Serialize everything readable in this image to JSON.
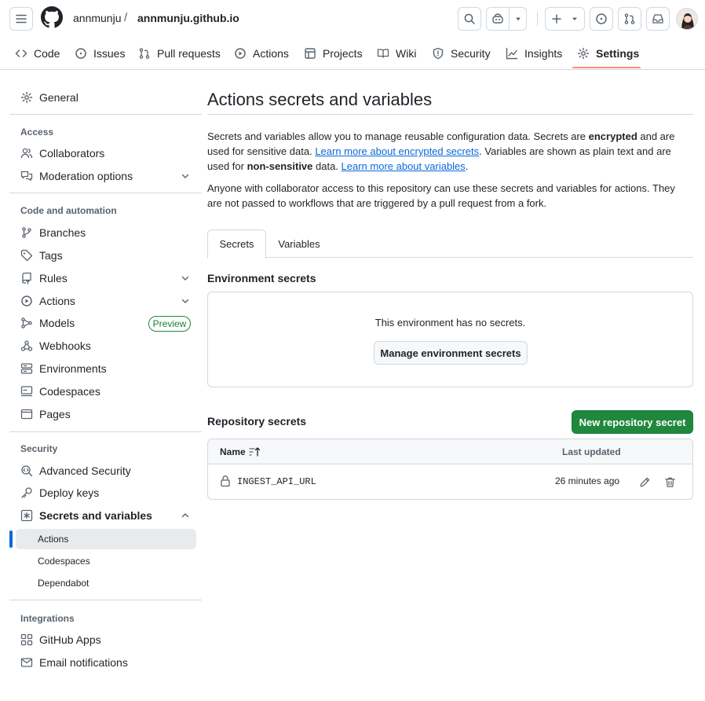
{
  "header": {
    "owner": "annmunju",
    "separator": "/",
    "repo": "annmunju.github.io"
  },
  "repo_tabs": [
    {
      "label": "Code",
      "icon": "code-icon"
    },
    {
      "label": "Issues",
      "icon": "issue-opened-icon"
    },
    {
      "label": "Pull requests",
      "icon": "git-pull-request-icon"
    },
    {
      "label": "Actions",
      "icon": "play-icon"
    },
    {
      "label": "Projects",
      "icon": "table-icon"
    },
    {
      "label": "Wiki",
      "icon": "book-icon"
    },
    {
      "label": "Security",
      "icon": "shield-icon"
    },
    {
      "label": "Insights",
      "icon": "graph-icon"
    },
    {
      "label": "Settings",
      "icon": "gear-icon",
      "active": true
    }
  ],
  "sidebar": {
    "general": "General",
    "access_heading": "Access",
    "collaborators": "Collaborators",
    "moderation": "Moderation options",
    "code_heading": "Code and automation",
    "branches": "Branches",
    "tags": "Tags",
    "rules": "Rules",
    "actions": "Actions",
    "models": "Models",
    "models_badge": "Preview",
    "webhooks": "Webhooks",
    "environments": "Environments",
    "codespaces": "Codespaces",
    "pages": "Pages",
    "security_heading": "Security",
    "advanced_security": "Advanced Security",
    "deploy_keys": "Deploy keys",
    "secrets": "Secrets and variables",
    "sub_actions": "Actions",
    "sub_codespaces": "Codespaces",
    "sub_dependabot": "Dependabot",
    "integrations_heading": "Integrations",
    "github_apps": "GitHub Apps",
    "email_notifications": "Email notifications"
  },
  "main": {
    "title": "Actions secrets and variables",
    "intro": {
      "t1": "Secrets and variables allow you to manage reusable configuration data. Secrets are ",
      "b1": "encrypted",
      "t2": " and are used for sensitive data. ",
      "link1": "Learn more about encrypted secrets",
      "t3": ". Variables are shown as plain text and are used for ",
      "b2": "non-sensitive",
      "t4": " data. ",
      "link2": "Learn more about variables",
      "t5": "."
    },
    "access_note": "Anyone with collaborator access to this repository can use these secrets and variables for actions. They are not passed to workflows that are triggered by a pull request from a fork.",
    "tabs": {
      "secrets": "Secrets",
      "variables": "Variables"
    },
    "env_title": "Environment secrets",
    "env_empty": "This environment has no secrets.",
    "env_button": "Manage environment secrets",
    "repo_title": "Repository secrets",
    "new_button": "New repository secret",
    "table": {
      "col_name": "Name",
      "col_updated": "Last updated",
      "rows": [
        {
          "name": "INGEST_API_URL",
          "updated": "26 minutes ago"
        }
      ]
    }
  },
  "colors": {
    "accent": "#0969da",
    "primary_button": "#1f883d",
    "tab_underline": "#fd8c73"
  }
}
